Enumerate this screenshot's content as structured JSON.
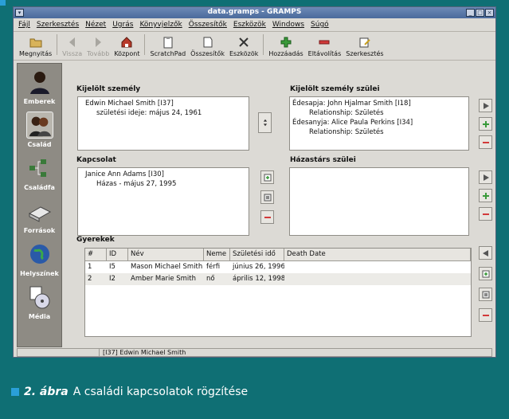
{
  "window": {
    "title": "data.gramps - GRAMPS"
  },
  "menubar": [
    "Fájl",
    "Szerkesztés",
    "Nézet",
    "Ugrás",
    "Könyvjelzők",
    "Összesítők",
    "Eszközök",
    "Windows",
    "Súgó"
  ],
  "toolbar": {
    "open": "Megnyitás",
    "back": "Vissza",
    "forward": "Tovább",
    "home": "Központ",
    "scratchpad": "ScratchPad",
    "reports": "Összesítők",
    "tools": "Eszközök",
    "add": "Hozzáadás",
    "remove": "Eltávolítás",
    "edit": "Szerkesztés"
  },
  "sidebar": [
    "Emberek",
    "Család",
    "Családfa",
    "Források",
    "Helyszínek",
    "Média"
  ],
  "active_person": {
    "label": "Kijelölt személy",
    "name": "Edwin Michael Smith [I37]",
    "detail": "születési ideje: május 24, 1961"
  },
  "active_parents": {
    "label": "Kijelölt személy szülei",
    "lines": [
      "Édesapja: John Hjalmar Smith [I18]",
      "Relationship: Születés",
      "Édesanyja: Alice Paula Perkins [I34]",
      "Relationship: Születés"
    ]
  },
  "spouse": {
    "label": "Kapcsolat",
    "name": "Janice Ann Adams [I30]",
    "detail": "Házas - május 27, 1995"
  },
  "spouse_parents": {
    "label": "Házastárs szülei"
  },
  "children": {
    "label": "Gyerekek",
    "columns": [
      "#",
      "ID",
      "Név",
      "Neme",
      "Születési idő",
      "Death Date"
    ],
    "rows": [
      [
        "1",
        "I5",
        "Mason Michael Smith",
        "férfi",
        "június 26, 1996",
        ""
      ],
      [
        "2",
        "I2",
        "Amber Marie Smith",
        "nő",
        "április 12, 1998",
        ""
      ]
    ]
  },
  "statusbar": {
    "text": "[I37] Edwin Michael Smith"
  },
  "caption": {
    "figure": "2. ábra",
    "text": "A családi kapcsolatok rögzítése"
  },
  "colors": {
    "background": "#0f6f74",
    "accent": "#2a9fd8",
    "titlebar": "#4a6a9c",
    "window": "#dcdad5"
  }
}
